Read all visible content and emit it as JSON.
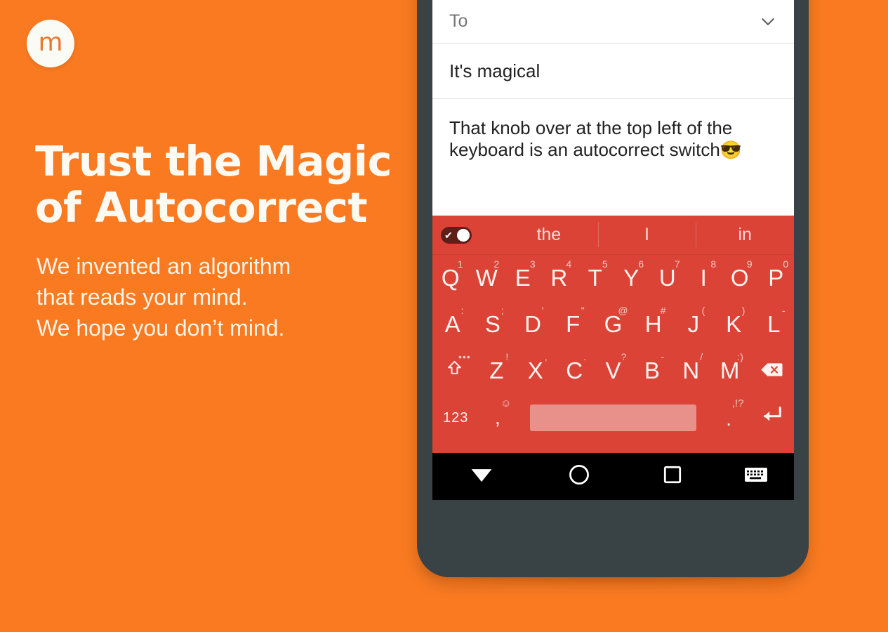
{
  "brand": {
    "logo_glyph": "m",
    "logo_icon": "minuum-m-logo",
    "background_color": "#f97a21"
  },
  "promo": {
    "headline": "Trust the Magic of Autocorrect",
    "headline_lines": [
      "Trust the Magic",
      "of Autocorrect"
    ],
    "subhead_lines": [
      "We invented an algorithm",
      "that reads your mind.",
      "We hope you don’t mind."
    ]
  },
  "phone": {
    "body_color": "#394244",
    "screen": {
      "compose": {
        "to_label": "To",
        "to_chevron_icon": "chevron-down-icon",
        "subject": "It's magical",
        "body": "That knob over at the top left of the keyboard is an autocorrect switch",
        "body_emoji": "😎"
      },
      "keyboard": {
        "key_color": "#db4336",
        "spacebar_color": "#e8918a",
        "autocorrect_toggle": {
          "name": "autocorrect-switch",
          "state": "on",
          "check_glyph": "✔"
        },
        "suggestions": [
          "the",
          "I",
          "in"
        ],
        "rows": [
          {
            "id": "row1",
            "keys": [
              {
                "label": "Q",
                "sup": "1"
              },
              {
                "label": "W",
                "sup": "2"
              },
              {
                "label": "E",
                "sup": "3"
              },
              {
                "label": "R",
                "sup": "4"
              },
              {
                "label": "T",
                "sup": "5"
              },
              {
                "label": "Y",
                "sup": "6"
              },
              {
                "label": "U",
                "sup": "7"
              },
              {
                "label": "I",
                "sup": "8"
              },
              {
                "label": "O",
                "sup": "9"
              },
              {
                "label": "P",
                "sup": "0"
              }
            ]
          },
          {
            "id": "row2",
            "keys": [
              {
                "label": "A",
                "sup": ":"
              },
              {
                "label": "S",
                "sup": ";"
              },
              {
                "label": "D",
                "sup": "'"
              },
              {
                "label": "F",
                "sup": "\""
              },
              {
                "label": "G",
                "sup": "@"
              },
              {
                "label": "H",
                "sup": "#"
              },
              {
                "label": "J",
                "sup": "("
              },
              {
                "label": "K",
                "sup": ")"
              },
              {
                "label": "L",
                "sup": "-"
              }
            ]
          },
          {
            "id": "row3",
            "keys": [
              {
                "label": "shift-icon",
                "sup": "•••"
              },
              {
                "label": "Z",
                "sup": "!"
              },
              {
                "label": "X",
                "sup": ","
              },
              {
                "label": "C",
                "sup": "."
              },
              {
                "label": "V",
                "sup": "?"
              },
              {
                "label": "B",
                "sup": "-"
              },
              {
                "label": "N",
                "sup": "/"
              },
              {
                "label": "M",
                "sup": ":)"
              },
              {
                "label": "backspace-icon",
                "sup": ""
              }
            ]
          },
          {
            "id": "row4",
            "keys": [
              {
                "label": "123",
                "sup": ""
              },
              {
                "label": ",",
                "sup": "☺"
              },
              {
                "label": "space",
                "sup": ""
              },
              {
                "label": ".",
                "sup": ",!?"
              },
              {
                "label": "enter-icon",
                "sup": ""
              }
            ]
          }
        ]
      },
      "navbar": {
        "background_color": "#000000",
        "buttons": [
          {
            "name": "nav-back-hide-keyboard",
            "icon": "triangle-down-icon"
          },
          {
            "name": "nav-home",
            "icon": "circle-icon"
          },
          {
            "name": "nav-recents",
            "icon": "square-icon"
          },
          {
            "name": "nav-keyboard-switcher",
            "icon": "keyboard-icon"
          }
        ]
      }
    }
  }
}
